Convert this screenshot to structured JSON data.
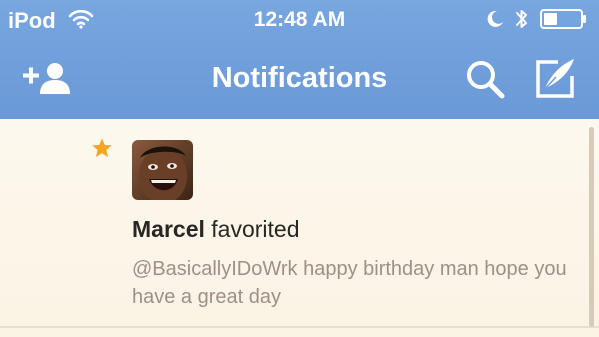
{
  "status_bar": {
    "carrier": "iPod",
    "time": "12:48 AM"
  },
  "nav": {
    "title": "Notifications"
  },
  "notification": {
    "actor": "Marcel",
    "action": "favorited",
    "tweet_text": "@BasicallyIDoWrk happy birthday man hope you have a great day"
  },
  "colors": {
    "header": "#6f9edb",
    "star": "#f5a623",
    "background": "#fbf4e6"
  },
  "icons": [
    "wifi-icon",
    "moon-icon",
    "bluetooth-icon",
    "battery-icon",
    "add-user-icon",
    "search-icon",
    "compose-icon",
    "star-icon"
  ]
}
